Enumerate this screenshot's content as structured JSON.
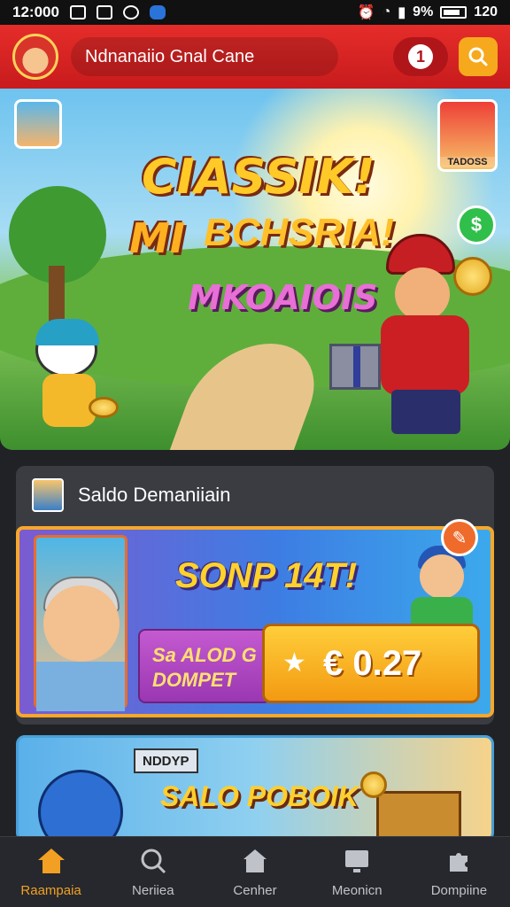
{
  "status_bar": {
    "time": "12:000",
    "right_text": "9%",
    "clock_right": "120"
  },
  "header": {
    "title": "Ndnanaiio Gnal Cane",
    "alert_label": "1"
  },
  "hero": {
    "line1": "CIASSIK!",
    "line2_a": "MI",
    "line2_b": "BCHSRIA!",
    "line3": "MKOAIOIS",
    "thumb_right_label": "TADOSS"
  },
  "section": {
    "title": "Saldo Demaniiain",
    "promo_title": "SONP 14T!",
    "wallet_label_line1": "Sa ALOD G",
    "wallet_label_line2": "DOMPET",
    "wallet_amount": "€ 0.27"
  },
  "card2": {
    "tag": "NDDYP",
    "title": "SALO POBOIK"
  },
  "bottom_nav": [
    {
      "label": "Raampaia",
      "icon": "home-icon",
      "active": true
    },
    {
      "label": "Neriiea",
      "icon": "search-icon",
      "active": false
    },
    {
      "label": "Cenher",
      "icon": "store-icon",
      "active": false
    },
    {
      "label": "Meonicn",
      "icon": "monitor-icon",
      "active": false
    },
    {
      "label": "Dompiine",
      "icon": "puzzle-icon",
      "active": false
    }
  ],
  "colors": {
    "header_red": "#d8241f",
    "accent_orange": "#f1a023",
    "nav_bg": "#26282d"
  }
}
